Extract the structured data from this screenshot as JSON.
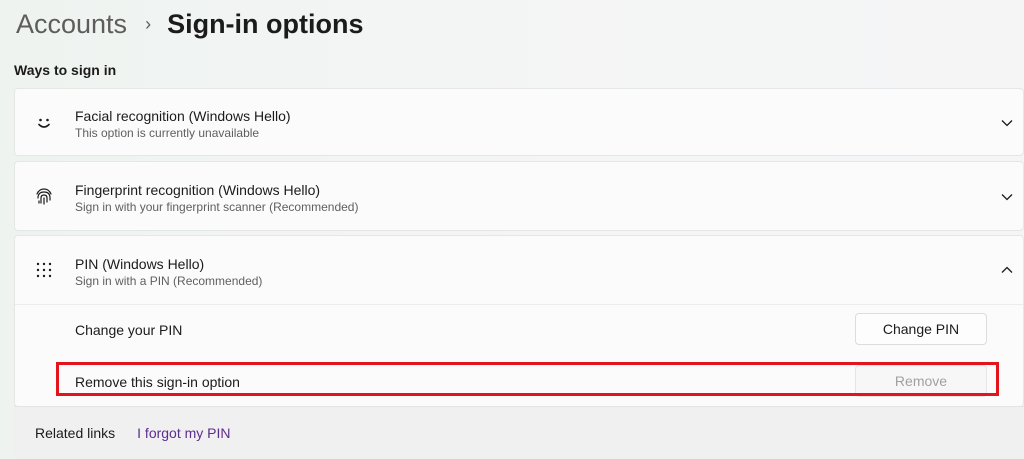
{
  "breadcrumb": {
    "parent": "Accounts",
    "separator": "›",
    "current": "Sign-in options"
  },
  "section_title": "Ways to sign in",
  "options": [
    {
      "icon": "smiley-face-icon",
      "title": "Facial recognition (Windows Hello)",
      "subtitle": "This option is currently unavailable",
      "expanded": false
    },
    {
      "icon": "fingerprint-icon",
      "title": "Fingerprint recognition (Windows Hello)",
      "subtitle": "Sign in with your fingerprint scanner (Recommended)",
      "expanded": false
    },
    {
      "icon": "pin-keypad-icon",
      "title": "PIN (Windows Hello)",
      "subtitle": "Sign in with a PIN (Recommended)",
      "expanded": true
    }
  ],
  "pin": {
    "change_label": "Change your PIN",
    "change_button": "Change PIN",
    "remove_label": "Remove this sign-in option",
    "remove_button": "Remove",
    "remove_disabled": true
  },
  "related": {
    "label": "Related links",
    "link": "I forgot my PIN"
  },
  "colors": {
    "highlight": "#e3141b",
    "link": "#5b2d8e"
  }
}
